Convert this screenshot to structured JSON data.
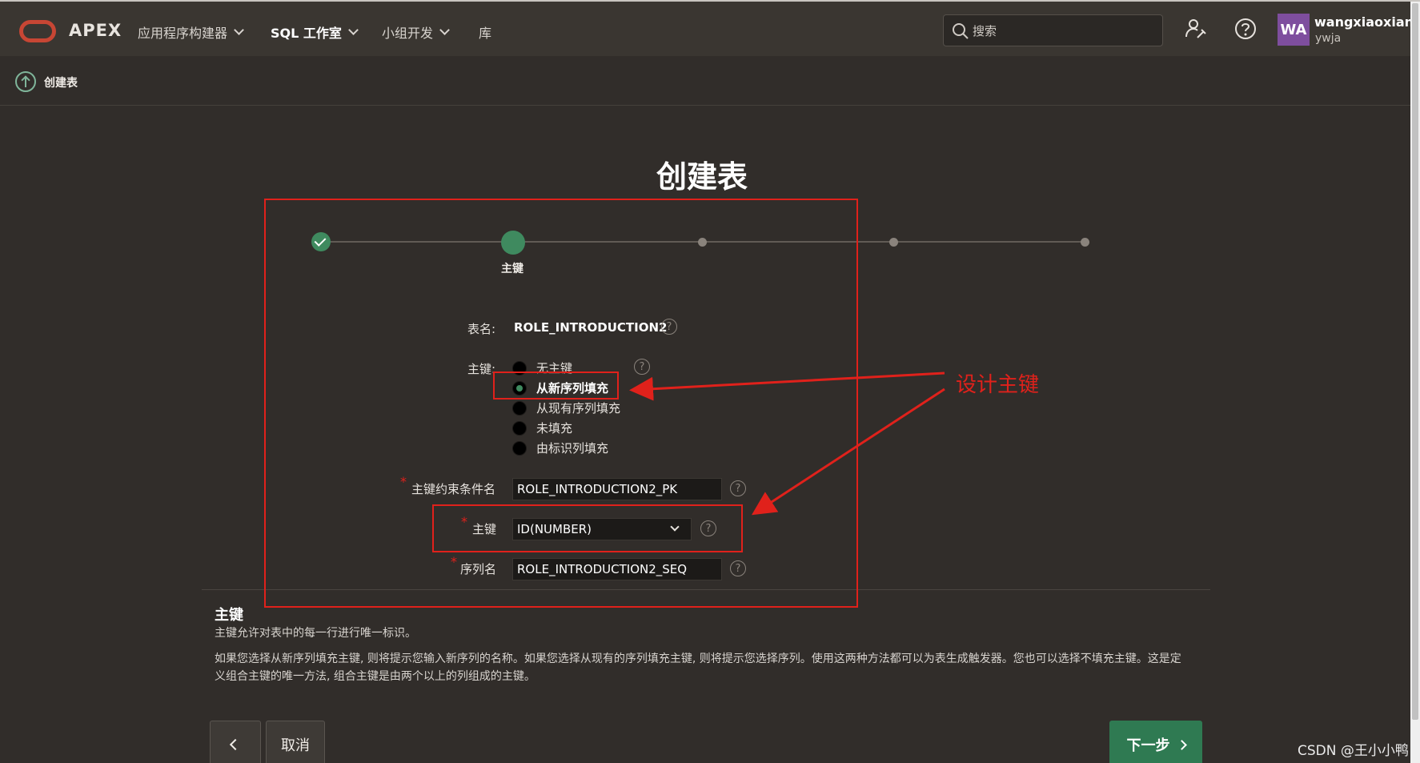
{
  "header": {
    "logo": "APEX",
    "nav": [
      {
        "label": "应用程序构建器",
        "dropdown": true
      },
      {
        "label": "SQL 工作室",
        "dropdown": true,
        "active": true
      },
      {
        "label": "小组开发",
        "dropdown": true
      },
      {
        "label": "库",
        "dropdown": false
      }
    ],
    "search_placeholder": "搜索",
    "avatar_initials": "WA",
    "user_name": "wangxiaoxian",
    "workspace": "ywja"
  },
  "breadcrumb": {
    "label": "创建表"
  },
  "page": {
    "title": "创建表"
  },
  "wizard": {
    "current_step_label": "主键",
    "steps_total": 5,
    "current_step": 2
  },
  "form": {
    "table_name_label": "表名:",
    "table_name_value": "ROLE_INTRODUCTION2",
    "pk_label": "主键:",
    "pk_options": [
      {
        "label": "无主键",
        "checked": false
      },
      {
        "label": "从新序列填充",
        "checked": true
      },
      {
        "label": "从现有序列填充",
        "checked": false
      },
      {
        "label": "未填充",
        "checked": false
      },
      {
        "label": "由标识列填充",
        "checked": false
      }
    ],
    "constraint_label": "主键约束条件名",
    "constraint_value": "ROLE_INTRODUCTION2_PK",
    "pk_column_label": "主键",
    "pk_column_value": "ID(NUMBER)",
    "sequence_label": "序列名",
    "sequence_value": "ROLE_INTRODUCTION2_SEQ",
    "required_mark": "*",
    "help_glyph": "?"
  },
  "help": {
    "title": "主键",
    "line1": "主键允许对表中的每一行进行唯一标识。",
    "line2": "如果您选择从新序列填充主键, 则将提示您输入新序列的名称。如果您选择从现有的序列填充主键, 则将提示您选择序列。使用这两种方法都可以为表生成触发器。您也可以选择不填充主键。这是定义组合主键的唯一方法, 组合主键是由两个以上的列组成的主键。"
  },
  "buttons": {
    "cancel": "取消",
    "next": "下一步"
  },
  "annotation": {
    "text": "设计主键"
  },
  "watermark": "CSDN @王小小鸭",
  "colors": {
    "accent_green": "#3f8a5f",
    "annotation_red": "#e0211b",
    "background": "#312d2a",
    "header": "#3a3631"
  }
}
